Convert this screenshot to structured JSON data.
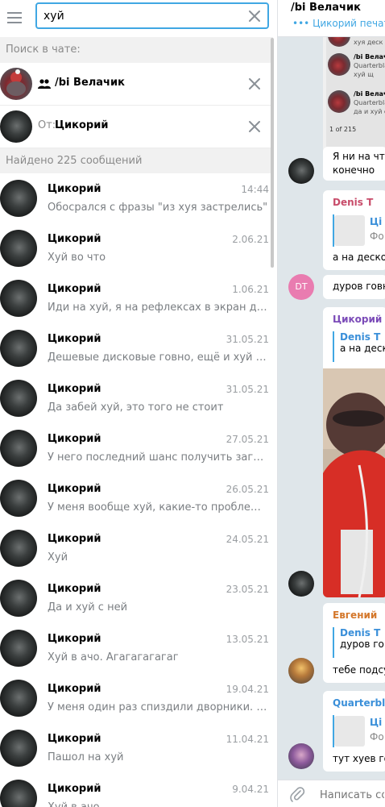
{
  "search": {
    "query": "хуй"
  },
  "sections": {
    "search_in_chat": "Поиск в чате:",
    "found": "Найдено 225 сообщений"
  },
  "filters": {
    "chat_name": "/bi Велачик",
    "from_label": "От:",
    "from_name": "Цикорий"
  },
  "results": [
    {
      "name": "Цикорий",
      "date": "14:44",
      "text": "Обосрался с фразы \"из хуя застрелись\""
    },
    {
      "name": "Цикорий",
      "date": "2.06.21",
      "text": "Хуй во что"
    },
    {
      "name": "Цикорий",
      "date": "1.06.21",
      "text": "Иди на хуй, я на рефлексах в экран дунул"
    },
    {
      "name": "Цикорий",
      "date": "31.05.21",
      "text": "Дешевые дисковые говно, ещё и хуй обсл..."
    },
    {
      "name": "Цикорий",
      "date": "31.05.21",
      "text": "Да забей хуй, это того не стоит"
    },
    {
      "name": "Цикорий",
      "date": "27.05.21",
      "text": "У него последний шанс получить загран б..."
    },
    {
      "name": "Цикорий",
      "date": "26.05.21",
      "text": "У меня вообще хуй, какие-то проблемы?"
    },
    {
      "name": "Цикорий",
      "date": "24.05.21",
      "text": "Хуй"
    },
    {
      "name": "Цикорий",
      "date": "23.05.21",
      "text": "Да и хуй с ней"
    },
    {
      "name": "Цикорий",
      "date": "13.05.21",
      "text": "Хуй в ачо. Агагагагагаг"
    },
    {
      "name": "Цикорий",
      "date": "19.04.21",
      "text": "У меня один раз спиздили дворники. Кото..."
    },
    {
      "name": "Цикорий",
      "date": "11.04.21",
      "text": "Пашол на хуй"
    },
    {
      "name": "Цикорий",
      "date": "9.04.21",
      "text": "Хуй в ачо..."
    }
  ],
  "chat": {
    "title": "/bi Велачик",
    "status": "Цикорий печат",
    "composer_placeholder": "Написать соо",
    "page_counter": "1 of 215",
    "preview_items": [
      {
        "title": "/bi Велачик",
        "sub": "Quarterbla",
        "line": "хуй щ"
      },
      {
        "title": "/bi Велачик",
        "sub": "Quarterbla",
        "line": "да и хуй с"
      }
    ],
    "preview_top_line": "хуя деск",
    "msg1_lines": [
      "Я ни на что",
      "конечно"
    ],
    "msg2": {
      "sender": "Denis T",
      "reply_name": "Ці",
      "reply_text": "Фо",
      "text": "а на деско"
    },
    "dt_initials": "DT",
    "msg3_text": "дуров говн",
    "msg4": {
      "sender": "Цикорий",
      "reply_name": "Denis T",
      "reply_text": "а на деск"
    },
    "msg5": {
      "sender": "Евгений",
      "reply_name": "Denis T",
      "reply_text": "дуров го",
      "text": "тебе подсу"
    },
    "msg6": {
      "sender": "Quarterbla",
      "reply_name": "Ці",
      "reply_text": "Фо",
      "text": "тут хуев го"
    },
    "colors": {
      "accent": "#40a7e3",
      "denis": "#c84c6a",
      "cikoriy": "#7b4bb8",
      "evgeniy": "#d4772a",
      "quarter": "#3a8fd9"
    }
  }
}
